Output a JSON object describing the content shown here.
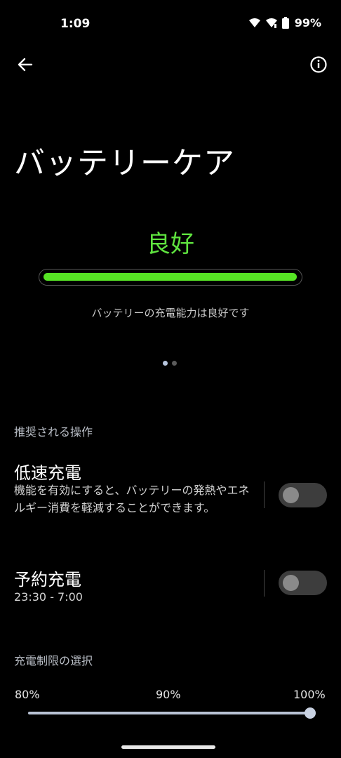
{
  "status_bar": {
    "time": "1:09",
    "battery": "99%"
  },
  "header": {
    "title": "バッテリーケア",
    "icons": {
      "back": "arrow-left-icon",
      "info": "info-icon"
    }
  },
  "health": {
    "status": "良好",
    "level_fraction": 1.0,
    "description": "バッテリーの充電能力は良好です",
    "pager": {
      "count": 2,
      "active": 0
    }
  },
  "recommended": {
    "section_label": "推奨される操作",
    "slow_charge": {
      "title": "低速充電",
      "description": "機能を有効にすると、バッテリーの発熱やエネルギー消費を軽減することができます。",
      "enabled": false
    },
    "scheduled_charge": {
      "title": "予約充電",
      "time_range": "23:30 - 7:00",
      "enabled": false
    }
  },
  "charge_limit": {
    "section_label": "充電制限の選択",
    "options": [
      "80%",
      "90%",
      "100%"
    ],
    "selected": "100%",
    "selected_index": 2
  },
  "colors": {
    "accent_green": "#5fe43f",
    "bar_fill": "#56e324",
    "pager_active": "#b7c5dd",
    "pager_inactive": "#5b5b5b"
  }
}
